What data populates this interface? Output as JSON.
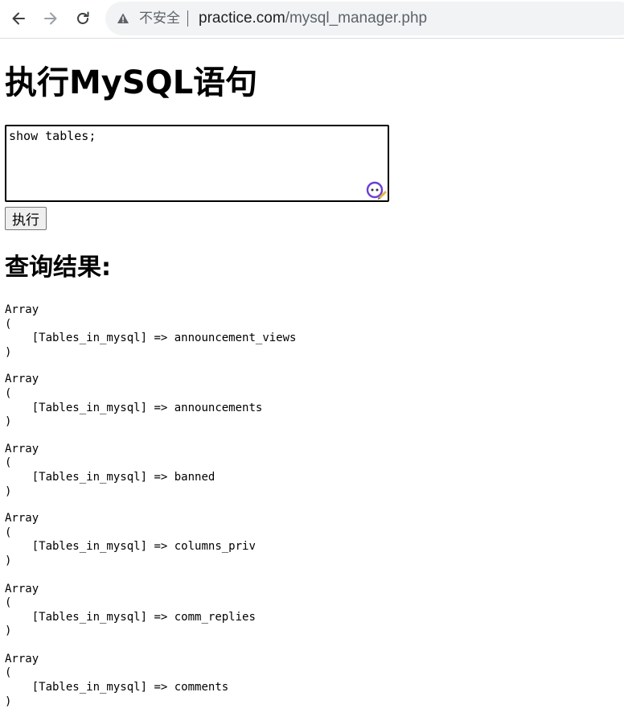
{
  "browser": {
    "security_label": "不安全",
    "url_host": "practice.com",
    "url_path": "/mysql_manager.php",
    "icons": [
      "back-arrow-icon",
      "forward-arrow-icon",
      "reload-icon",
      "warning-icon"
    ]
  },
  "page": {
    "title": "执行MySQL语句",
    "query_value": "show tables;",
    "execute_label": "执行",
    "results_heading": "查询结果:"
  },
  "results": [
    {
      "open": "Array",
      "paren_open": "(",
      "key": "[Tables_in_mysql]",
      "arrow": "=>",
      "value": "announcement_views",
      "paren_close": ")"
    },
    {
      "open": "Array",
      "paren_open": "(",
      "key": "[Tables_in_mysql]",
      "arrow": "=>",
      "value": "announcements",
      "paren_close": ")"
    },
    {
      "open": "Array",
      "paren_open": "(",
      "key": "[Tables_in_mysql]",
      "arrow": "=>",
      "value": "banned",
      "paren_close": ")"
    },
    {
      "open": "Array",
      "paren_open": "(",
      "key": "[Tables_in_mysql]",
      "arrow": "=>",
      "value": "columns_priv",
      "paren_close": ")"
    },
    {
      "open": "Array",
      "paren_open": "(",
      "key": "[Tables_in_mysql]",
      "arrow": "=>",
      "value": "comm_replies",
      "paren_close": ")"
    },
    {
      "open": "Array",
      "paren_open": "(",
      "key": "[Tables_in_mysql]",
      "arrow": "=>",
      "value": "comments",
      "paren_close": ")"
    }
  ]
}
